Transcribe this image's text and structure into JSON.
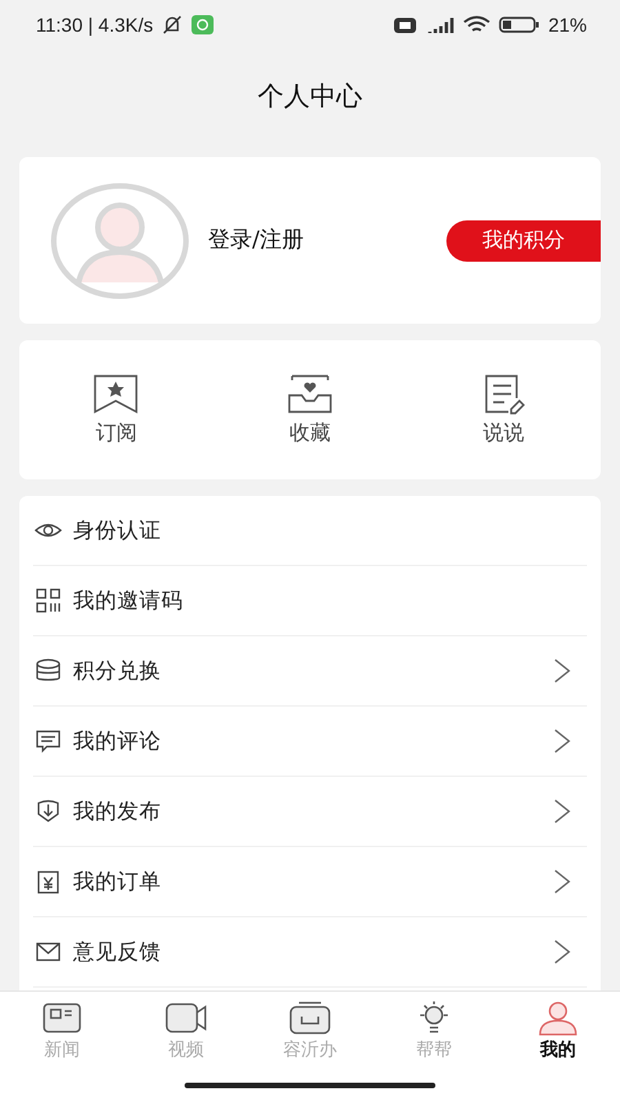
{
  "status_bar": {
    "time": "11:30 | 4.3K/s",
    "battery": "21%"
  },
  "header": {
    "title": "个人中心"
  },
  "profile": {
    "login": "登录/注册",
    "points_button": "我的积分"
  },
  "shortcuts": [
    {
      "kind": "subscribe",
      "label": "订阅"
    },
    {
      "kind": "favorites",
      "label": "收藏"
    },
    {
      "kind": "posts",
      "label": "说说"
    }
  ],
  "menu": [
    {
      "kind": "eye",
      "label": "身份认证",
      "chevron": false
    },
    {
      "kind": "qr",
      "label": "我的邀请码",
      "chevron": false
    },
    {
      "kind": "coins",
      "label": "积分兑换",
      "chevron": true
    },
    {
      "kind": "comment",
      "label": "我的评论",
      "chevron": true
    },
    {
      "kind": "publish",
      "label": "我的发布",
      "chevron": true
    },
    {
      "kind": "order",
      "label": "我的订单",
      "chevron": true
    },
    {
      "kind": "mail",
      "label": "意见反馈",
      "chevron": true
    }
  ],
  "tab_bar": [
    {
      "kind": "news",
      "label": "新闻",
      "selected": false
    },
    {
      "kind": "video",
      "label": "视频",
      "selected": false
    },
    {
      "kind": "box",
      "label": "容沂办",
      "selected": false
    },
    {
      "kind": "bulb",
      "label": "帮帮",
      "selected": false
    },
    {
      "kind": "person",
      "label": "我的",
      "selected": true
    }
  ]
}
